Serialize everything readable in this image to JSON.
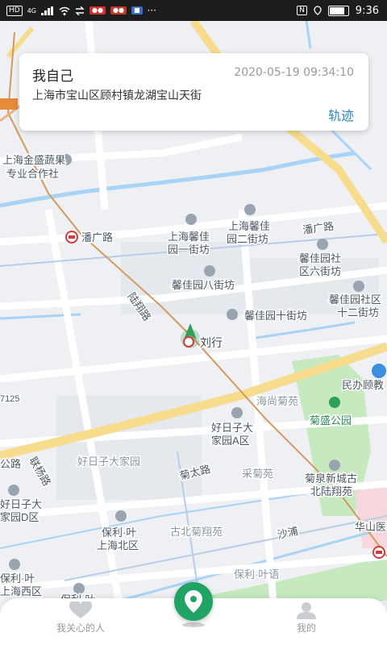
{
  "status_bar": {
    "network": "4G",
    "time": "9:36",
    "hd_label": "HD"
  },
  "location_card": {
    "person": "我自己",
    "timestamp": "2020-05-19 09:34:10",
    "address": "上海市宝山区顾村镇龙湖宝山天街",
    "track_label": "轨迹"
  },
  "map": {
    "current_marker_label": "刘行",
    "labels": {
      "farm_line1": "上海金盛蔬果",
      "farm_line2": "专业合作社",
      "metro_panguang": "潘广路",
      "panguang_road": "潘广路",
      "xinjia_1_l1": "上海馨佳",
      "xinjia_1_l2": "园一街坊",
      "xinjia_2_l1": "上海馨佳",
      "xinjia_2_l2": "园二街坊",
      "xinjia_6_l1": "馨佳园社",
      "xinjia_6_l2": "区六街坊",
      "xinjia_8": "馨佳园八街坊",
      "xinjia_12_l1": "馨佳园社区",
      "xinjia_12_l2": "十二街坊",
      "xinjia_10": "馨佳园十街坊",
      "lujiao_road": "陆翔路",
      "liuxing": "刘行",
      "minban": "民办顾教",
      "haishang": "海尚菊苑",
      "juxing_park": "菊盛公园",
      "hrzd_a_l1": "好日子大",
      "hrzd_a_l2": "家园A区",
      "hrzd": "好日子大家园",
      "lianyang_road": "联杨路",
      "juda_road": "菊太路",
      "caiju": "采菊苑",
      "juquan_l1": "菊泉新城古",
      "juquan_l2": "北陆翔苑",
      "hrzd_d_l1": "好日子大",
      "hrzd_d_l2": "家园D区",
      "poly_north_l1": "保利·叶",
      "poly_north_l2": "上海北区",
      "gubei": "古北菊翔苑",
      "shapu": "沙浦",
      "huashan": "华山医",
      "poly_west_l1": "保利·叶",
      "poly_west_l2": "上海西区",
      "poly_yeyu": "保利·叶语",
      "s7125": "7125",
      "gong_road": "公路",
      "poly_bottom": "保利·叶"
    }
  },
  "bottom_nav": {
    "care_label": "我关心的人",
    "me_label": "我的"
  },
  "colors": {
    "accent_green": "#1fa463",
    "track_blue": "#2b86c8",
    "status_bar_bg": "#1d1d1d"
  }
}
